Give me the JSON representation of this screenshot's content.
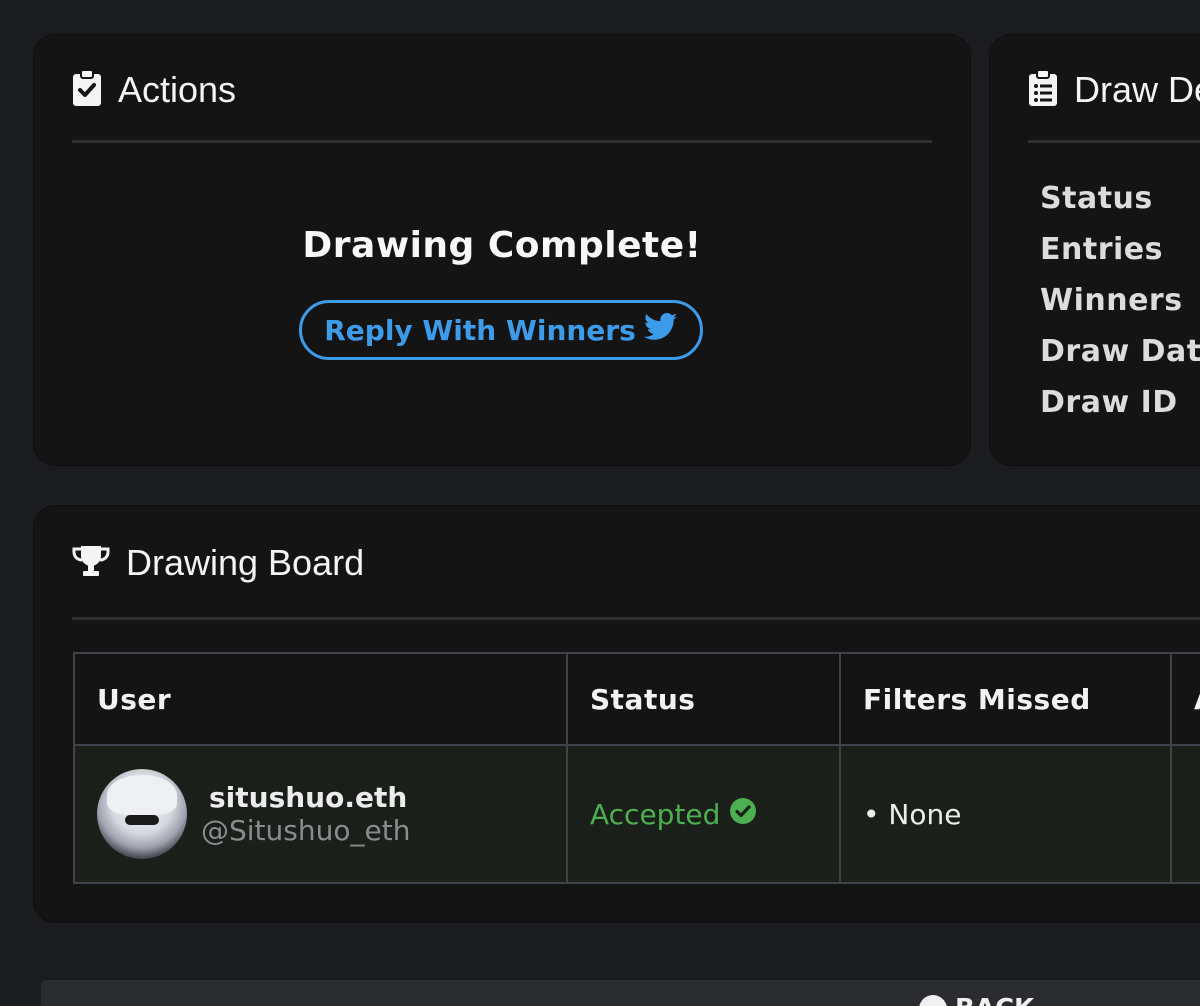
{
  "actions": {
    "title": "Actions",
    "icon": "clipboard-check-icon",
    "complete_text": "Drawing Complete!",
    "reply_button_label": "Reply With Winners",
    "reply_button_icon": "twitter-icon",
    "accent_color": "#3d9cea"
  },
  "details": {
    "title": "Draw De",
    "icon": "clipboard-list-icon",
    "labels": [
      "Status",
      "Entries",
      "Winners",
      "Draw Date",
      "Draw ID"
    ]
  },
  "board": {
    "title": "Drawing Board",
    "icon": "trophy-icon",
    "columns": [
      "User",
      "Status",
      "Filters Missed",
      "A"
    ],
    "rows": [
      {
        "name": "situshuo.eth",
        "handle": "@Situshuo_eth",
        "status": "Accepted",
        "status_color": "#4caf50",
        "filters_missed": "• None"
      }
    ]
  },
  "footer": {
    "back_label": "BACK"
  }
}
